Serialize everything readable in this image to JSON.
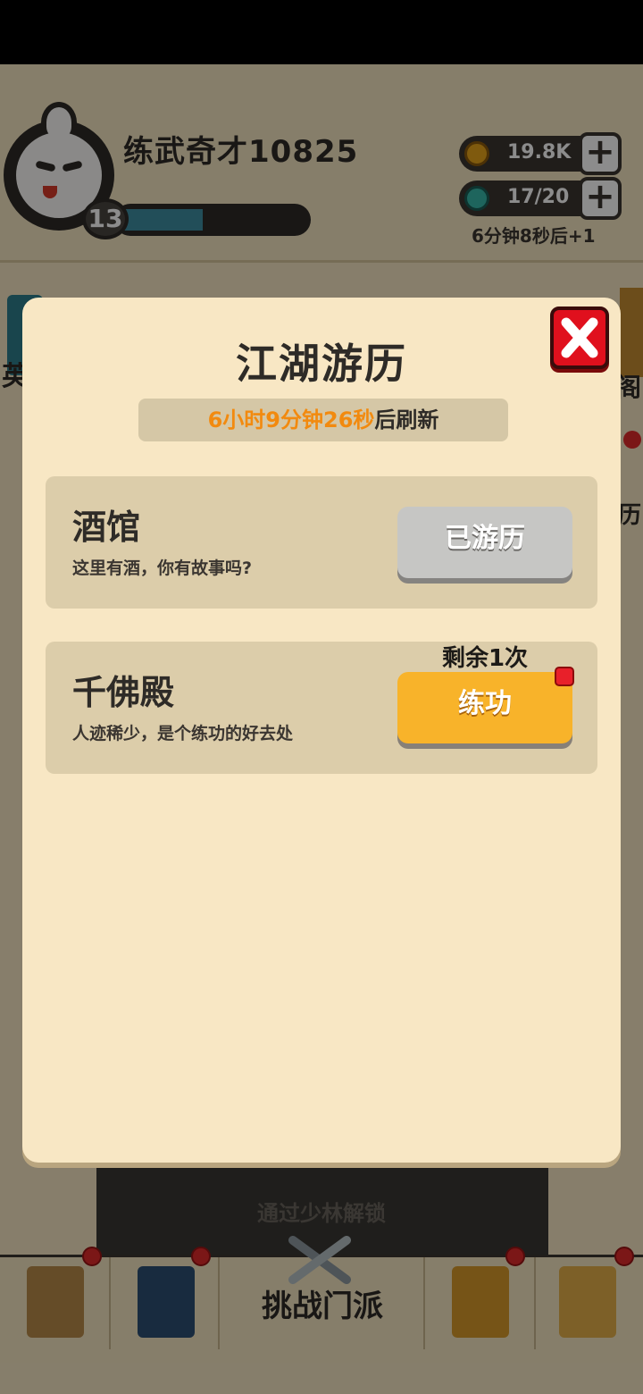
{
  "player": {
    "name": "练武奇才10825",
    "level": "13",
    "xp_fraction": 0.45
  },
  "resources": {
    "gold": "19.8K",
    "energy": "17/20",
    "energy_timer": "6分钟8秒后+1",
    "plus": "+"
  },
  "side": {
    "left_label": "英",
    "right_label": "阁",
    "right2_label": "历"
  },
  "unlock_text": "通过少林解锁",
  "bottom_nav": {
    "center_label": "挑战门派"
  },
  "modal": {
    "title": "江湖游历",
    "refresh_time": "6小时9分钟26秒",
    "refresh_suffix": "后刷新",
    "cards": [
      {
        "title": "酒馆",
        "desc": "这里有酒，你有故事吗?",
        "button": "已游历"
      },
      {
        "title": "千佛殿",
        "desc": "人迹稀少，是个练功的好去处",
        "button": "练功",
        "remaining": "剩余1次"
      }
    ]
  },
  "colors": {
    "accent_orange": "#f28a0f",
    "button_yellow": "#f8b32a",
    "button_gray": "#c6c6c4",
    "close_red": "#e0101d"
  }
}
